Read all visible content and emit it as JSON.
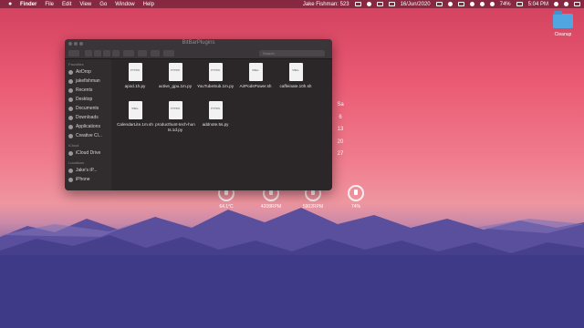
{
  "menubar": {
    "apple_icon": "apple-icon",
    "menus": [
      "Finder",
      "File",
      "Edit",
      "View",
      "Go",
      "Window",
      "Help"
    ],
    "user": "Jake Fishman: 523",
    "date": "16/Jun/2020",
    "battery": "74%",
    "time": "5:04 PM"
  },
  "desktop_folder": {
    "label": "Cleanup"
  },
  "calendar": {
    "header": "Sa",
    "days": [
      "6",
      "13",
      "20",
      "27"
    ]
  },
  "stats": [
    "64.1°C",
    "4208RPM",
    "5902RPM",
    "74%"
  ],
  "finder": {
    "title": "BitBarPlugins",
    "search_placeholder": "Search",
    "sidebar": {
      "favorites_label": "Favorites",
      "favorites": [
        "AirDrop",
        "jakefishman",
        "Recents",
        "Desktop",
        "Documents",
        "Downloads",
        "Applications",
        "Creative Cl..."
      ],
      "icloud_label": "iCloud",
      "icloud": [
        "iCloud Drive"
      ],
      "locations_label": "Locations",
      "locations": [
        "Jake's iP...",
        "iPhone"
      ]
    },
    "files": [
      {
        "name": "apod.1h.py",
        "tag": "PYTHON"
      },
      {
        "name": "active_gpu.1m.py",
        "tag": "PYTHON"
      },
      {
        "name": "YouTubeSub.1m.py",
        "tag": "PYTHON"
      },
      {
        "name": "AirPodsPower.sh",
        "tag": "SHELL"
      },
      {
        "name": "caffeinate.10h.sh",
        "tag": "SHELL"
      },
      {
        "name": "CalendarLite.1m.sh",
        "tag": "SHELL"
      },
      {
        "name": "producthunt-tech-hunts.1d.py",
        "tag": "PYTHON"
      },
      {
        "name": "addnote.5s.py",
        "tag": "PYTHON"
      }
    ]
  }
}
